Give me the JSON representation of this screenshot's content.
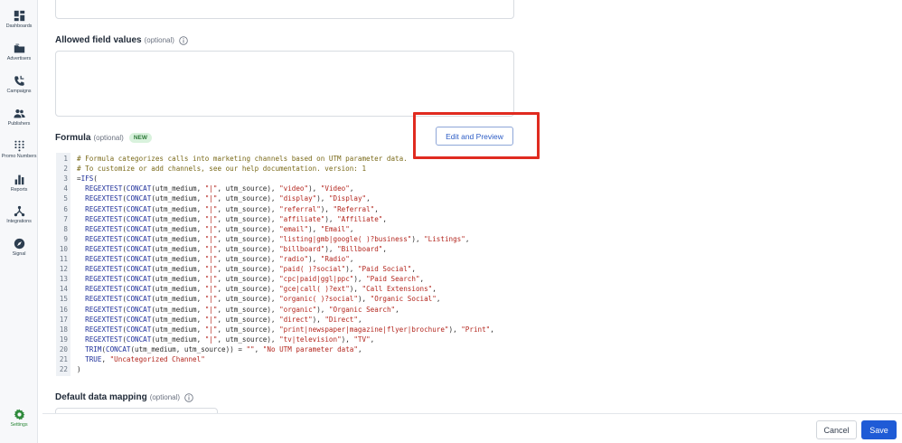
{
  "sidebar": {
    "items": [
      {
        "label": "Dashboards",
        "icon": "dashboard-icon"
      },
      {
        "label": "Advertisers",
        "icon": "folder-icon"
      },
      {
        "label": "Campaigns",
        "icon": "phone-icon"
      },
      {
        "label": "Publishers",
        "icon": "people-icon"
      },
      {
        "label": "Promo Numbers",
        "icon": "keypad-icon"
      },
      {
        "label": "Reports",
        "icon": "bar-chart-icon"
      },
      {
        "label": "Integrations",
        "icon": "integrations-icon"
      },
      {
        "label": "Signal",
        "icon": "compass-icon"
      },
      {
        "label": "Settings",
        "icon": "gear-icon"
      }
    ],
    "active_item": "Settings",
    "active_color": "#2f8a3c"
  },
  "allowed_values": {
    "label": "Allowed field values",
    "optional": "(optional)"
  },
  "formula": {
    "label": "Formula",
    "optional": "(optional)",
    "badge": "NEW",
    "edit_button": "Edit and Preview",
    "lines": [
      {
        "num": "1",
        "text": "# Formula categorizes calls into marketing channels based on UTM parameter data."
      },
      {
        "num": "2",
        "text": "# To customize or add channels, see our help documentation. version: 1"
      },
      {
        "num": "3",
        "text": "=IFS("
      },
      {
        "num": "4",
        "text": "  REGEXTEST(CONCAT(utm_medium, \"|\", utm_source), \"video\"), \"Video\","
      },
      {
        "num": "5",
        "text": "  REGEXTEST(CONCAT(utm_medium, \"|\", utm_source), \"display\"), \"Display\","
      },
      {
        "num": "6",
        "text": "  REGEXTEST(CONCAT(utm_medium, \"|\", utm_source), \"referral\"), \"Referral\","
      },
      {
        "num": "7",
        "text": "  REGEXTEST(CONCAT(utm_medium, \"|\", utm_source), \"affiliate\"), \"Affiliate\","
      },
      {
        "num": "8",
        "text": "  REGEXTEST(CONCAT(utm_medium, \"|\", utm_source), \"email\"), \"Email\","
      },
      {
        "num": "9",
        "text": "  REGEXTEST(CONCAT(utm_medium, \"|\", utm_source), \"listing|gmb|google( )?business\"), \"Listings\","
      },
      {
        "num": "10",
        "text": "  REGEXTEST(CONCAT(utm_medium, \"|\", utm_source), \"billboard\"), \"Billboard\","
      },
      {
        "num": "11",
        "text": "  REGEXTEST(CONCAT(utm_medium, \"|\", utm_source), \"radio\"), \"Radio\","
      },
      {
        "num": "12",
        "text": "  REGEXTEST(CONCAT(utm_medium, \"|\", utm_source), \"paid( )?social\"), \"Paid Social\","
      },
      {
        "num": "13",
        "text": "  REGEXTEST(CONCAT(utm_medium, \"|\", utm_source), \"cpc|paid|ggl|ppc\"), \"Paid Search\","
      },
      {
        "num": "14",
        "text": "  REGEXTEST(CONCAT(utm_medium, \"|\", utm_source), \"gce|call( )?ext\"), \"Call Extensions\","
      },
      {
        "num": "15",
        "text": "  REGEXTEST(CONCAT(utm_medium, \"|\", utm_source), \"organic( )?social\"), \"Organic Social\","
      },
      {
        "num": "16",
        "text": "  REGEXTEST(CONCAT(utm_medium, \"|\", utm_source), \"organic\"), \"Organic Search\","
      },
      {
        "num": "17",
        "text": "  REGEXTEST(CONCAT(utm_medium, \"|\", utm_source), \"direct\"), \"Direct\","
      },
      {
        "num": "18",
        "text": "  REGEXTEST(CONCAT(utm_medium, \"|\", utm_source), \"print|newspaper|magazine|flyer|brochure\"), \"Print\","
      },
      {
        "num": "19",
        "text": "  REGEXTEST(CONCAT(utm_medium, \"|\", utm_source), \"tv|television\"), \"TV\","
      },
      {
        "num": "20",
        "text": "  TRIM(CONCAT(utm_medium, utm_source)) = \"\", \"No UTM parameter data\","
      },
      {
        "num": "21",
        "text": "  TRUE, \"Uncategorized Channel\""
      },
      {
        "num": "22",
        "text": ")"
      }
    ]
  },
  "default_mapping": {
    "label": "Default data mapping",
    "optional": "(optional)"
  },
  "footer": {
    "cancel": "Cancel",
    "save": "Save",
    "save_color": "#1f5bd6"
  },
  "highlight_color": "#e02b20"
}
